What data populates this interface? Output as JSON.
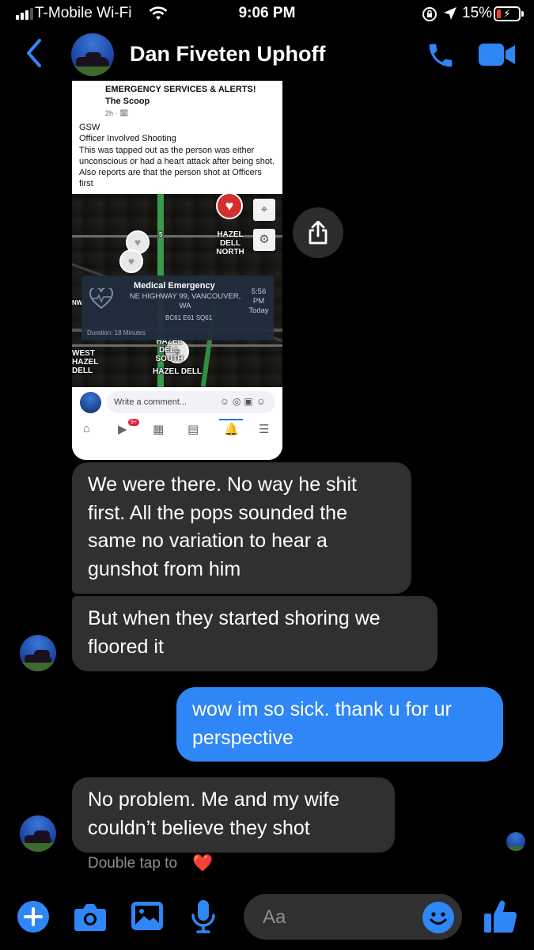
{
  "status_bar": {
    "carrier": "T-Mobile Wi-Fi",
    "time": "9:06 PM",
    "battery_percent": "15%",
    "signal_bars": 3
  },
  "header": {
    "contact_name": "Dan Fiveten Uphoff",
    "icons": [
      "back-chevron-icon",
      "phone-icon",
      "video-camera-icon"
    ]
  },
  "shared_post": {
    "source_title": "EMERGENCY SERVICES & ALERTS!",
    "source_subtitle": "The Scoop",
    "meta": "2h · 🗓",
    "lines": [
      "GSW",
      "Officer Involved Shooting",
      "This was tapped out as the person was either unconscious or had a heart attack after being shot. Also reports are that the person shot at Officers first"
    ],
    "map": {
      "labels": [
        "HAZEL DELL NORTH",
        "HAZEL DELL SOUTH",
        "WEST HAZEL DELL",
        "HAZEL DELL",
        "NW",
        "5"
      ],
      "popup_title": "Medical Emergency",
      "popup_address": "NE HIGHWAY 99, VANCOUVER, WA",
      "popup_codes": "BC61 E61 SQ61",
      "popup_time": "5:56 PM Today",
      "popup_duration": "Duration: 18 Minutes"
    },
    "comment_placeholder": "Write a comment...",
    "nav_badge": "9+"
  },
  "messages": [
    {
      "from": "contact",
      "text": "We were there.  No way he shit first.  All the pops sounded the same no variation to hear a gunshot from him"
    },
    {
      "from": "contact",
      "text": "But when they started shoring we floored it"
    },
    {
      "from": "me",
      "text": "wow im so sick. thank u for ur perspective"
    },
    {
      "from": "contact",
      "text": "No problem.  Me and my wife couldn’t believe they shot"
    }
  ],
  "reaction_hint": "Double tap to",
  "reaction_hint_emoji": "❤️",
  "composer": {
    "placeholder": "Aa",
    "icons": [
      "plus-icon",
      "camera-icon",
      "gallery-icon",
      "microphone-icon",
      "emoji-icon",
      "thumbs-up-icon"
    ]
  },
  "colors": {
    "accent": "#2f86f6",
    "incoming_bubble": "#303030",
    "background": "#000000"
  }
}
